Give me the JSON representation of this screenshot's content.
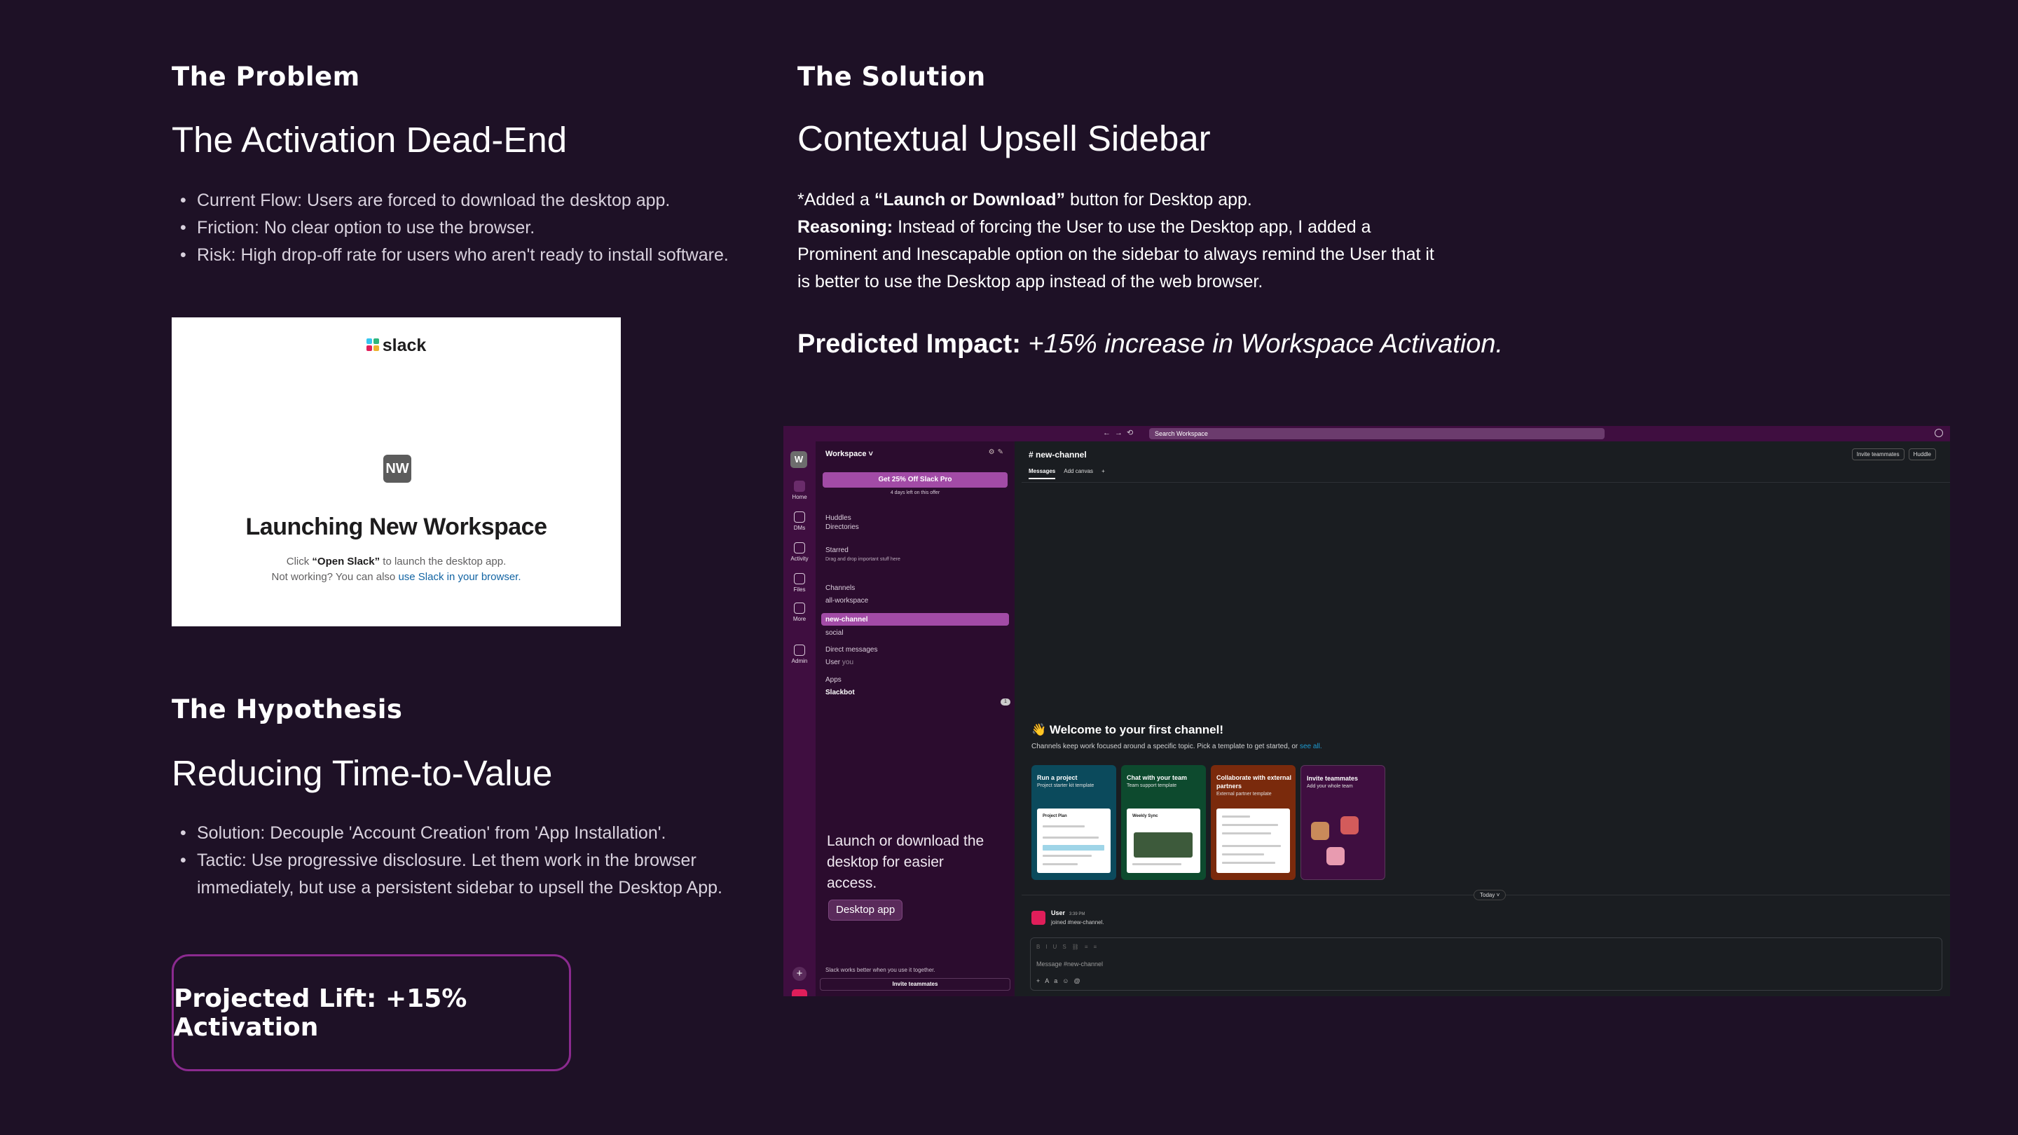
{
  "problem": {
    "label": "The Problem",
    "title": "The Activation Dead-End",
    "bullets": [
      "Current Flow: Users are forced to download the desktop app.",
      "Friction: No clear option to use the browser.",
      "Risk: High drop-off rate for users who aren't ready to install software."
    ]
  },
  "launch_mock": {
    "brand": "slack",
    "workspace_initials": "NW",
    "title": "Launching New Workspace",
    "line1_pre": "Click ",
    "line1_bold": "“Open Slack”",
    "line1_post": " to launch the desktop app.",
    "line2_pre": "Not working? You can also ",
    "line2_link": "use Slack in your browser."
  },
  "hypothesis": {
    "label": "The Hypothesis",
    "title": "Reducing Time-to-Value",
    "bullets": [
      "Solution: Decouple 'Account Creation' from 'App Installation'.",
      "Tactic: Use progressive disclosure. Let them work in the browser immediately, but use a persistent sidebar to upsell the Desktop App."
    ]
  },
  "lift": "Projected Lift: +15% Activation",
  "solution": {
    "label": "The Solution",
    "title": "Contextual Upsell Sidebar",
    "line1_pre": "*Added a ",
    "line1_bold": "“Launch or Download”",
    "line1_post": " button for Desktop app.",
    "reasoning_label": "Reasoning:",
    "reasoning_text": " Instead of forcing the User to use the Desktop app, I added a Prominent and Inescapable option on the sidebar to always remind the User that it is better to use the Desktop app instead of the web browser.",
    "impact_label": "Predicted Impact:",
    "impact_text": " +15% increase in Workspace Activation."
  },
  "app": {
    "search_placeholder": "Search Workspace",
    "workspace_initial": "W",
    "rail": [
      "Home",
      "DMs",
      "Activity",
      "Files",
      "More",
      "Admin"
    ],
    "workspace_name": "Workspace ˅",
    "promo": "Get 25% Off Slack Pro",
    "promo_sub": "4 days left on this offer",
    "huddles": "Huddles",
    "directories": "Directories",
    "starred": "Starred",
    "starred_hint": "Drag and drop important stuff here",
    "channels_header": "Channels",
    "channels": [
      "all-workspace",
      "new-channel",
      "social"
    ],
    "dm_header": "Direct messages",
    "dm_user": "User",
    "dm_you": "you",
    "apps_header": "Apps",
    "slackbot": "Slackbot",
    "slackbot_badge": "1",
    "cta_text": "Launch or download the desktop for easier access.",
    "cta_button": "Desktop app",
    "footer_text": "Slack works better when you use it together.",
    "invite_button": "Invite teammates",
    "channel_title": "# new-channel",
    "header_invite": "Invite teammates",
    "header_huddle": "Huddle",
    "tab_messages": "Messages",
    "tab_canvas": "Add canvas",
    "welcome_title": "👋 Welcome to your first channel!",
    "welcome_sub": "Channels keep work focused around a specific topic. Pick a template to get started, or ",
    "welcome_link": "see all.",
    "cards": [
      {
        "title": "Run a project",
        "sub": "Project starter kit template",
        "thumb": "Project Plan",
        "color": "#0b4a5c"
      },
      {
        "title": "Chat with your team",
        "sub": "Team support template",
        "thumb": "Weekly Sync",
        "color": "#0d4a2e"
      },
      {
        "title": "Collaborate with external partners",
        "sub": "External partner template",
        "thumb": "",
        "color": "#7a2a0c"
      },
      {
        "title": "Invite teammates",
        "sub": "Add your whole team",
        "thumb": "",
        "color": "#3f0e40"
      }
    ],
    "today": "Today ˅",
    "msg_user": "User",
    "msg_time": "3:39 PM",
    "msg_text": "joined #new-channel.",
    "composer_placeholder": "Message #new-channel"
  }
}
